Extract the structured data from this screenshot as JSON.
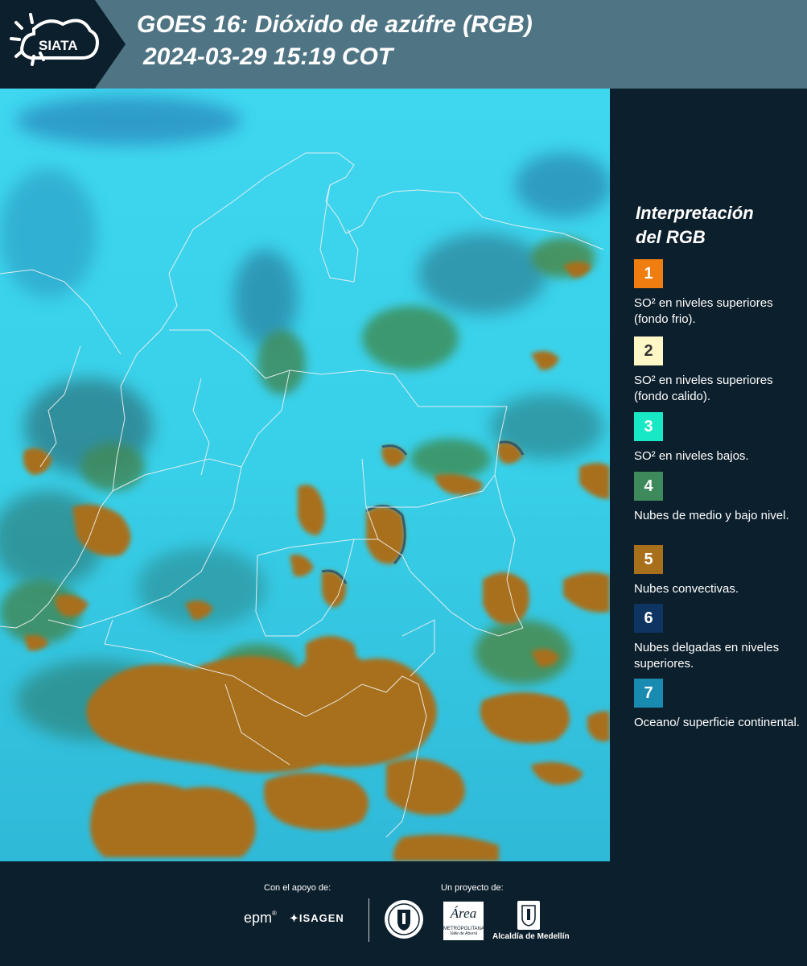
{
  "header": {
    "logo_text": "SIATA",
    "title": "GOES 16: Dióxido de azúfre (RGB)",
    "datetime": "2024-03-29 15:19 COT"
  },
  "legend": {
    "title_line1": "Interpretación",
    "title_line2": "del RGB",
    "items": [
      {
        "number": "1",
        "color": "#f07d10",
        "text": "SO² en niveles superiores (fondo frio)."
      },
      {
        "number": "2",
        "color": "#fff7c6",
        "text": "SO² en niveles superiores (fondo calido)."
      },
      {
        "number": "3",
        "color": "#19e8c6",
        "text": "SO² en niveles bajos."
      },
      {
        "number": "4",
        "color": "#3f8a5b",
        "text": "Nubes de medio y bajo nivel."
      },
      {
        "number": "5",
        "color": "#a8701b",
        "text": "Nubes convectivas."
      },
      {
        "number": "6",
        "color": "#0e3462",
        "text": "Nubes delgadas en niveles superiores."
      },
      {
        "number": "7",
        "color": "#1a8bb0",
        "text": "Oceano/ superficie continental."
      }
    ]
  },
  "footer": {
    "support_label": "Con el apoyo de:",
    "project_label": "Un proyecto de:",
    "sponsor_epm": "epm",
    "sponsor_isagen": "ISAGEN",
    "area_name": "Área",
    "area_sub1": "METROPOLITANA",
    "area_sub2": "Valle de Aburrá",
    "alcaldia": "Alcaldía de Medellín"
  }
}
